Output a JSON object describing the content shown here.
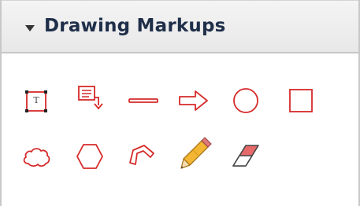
{
  "panel": {
    "title": "Drawing Markups",
    "expanded": true
  },
  "tools": [
    {
      "name": "text-box-tool",
      "icon": "text-box-icon",
      "glyph": "T"
    },
    {
      "name": "text-callout-tool",
      "icon": "text-callout-icon"
    },
    {
      "name": "line-tool",
      "icon": "line-icon"
    },
    {
      "name": "arrow-tool",
      "icon": "arrow-icon"
    },
    {
      "name": "oval-tool",
      "icon": "oval-icon"
    },
    {
      "name": "rectangle-tool",
      "icon": "rectangle-icon"
    },
    {
      "name": "cloud-tool",
      "icon": "cloud-icon"
    },
    {
      "name": "polygon-tool",
      "icon": "polygon-icon"
    },
    {
      "name": "polygon-line-tool",
      "icon": "polygon-line-icon"
    },
    {
      "name": "pencil-tool",
      "icon": "pencil-icon"
    },
    {
      "name": "eraser-tool",
      "icon": "eraser-icon"
    }
  ],
  "colors": {
    "icon_stroke": "#d62a2a",
    "pencil_body": "#f2b632",
    "eraser_fill": "#e66a6a"
  }
}
